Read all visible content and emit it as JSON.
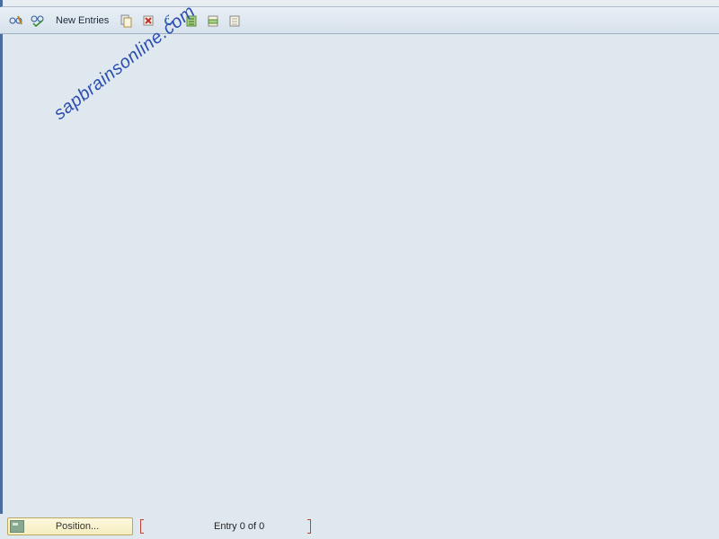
{
  "toolbar": {
    "display_details_tooltip": "Display/Change",
    "check_tooltip": "Check",
    "new_entries_label": "New Entries",
    "copy_tooltip": "Copy As",
    "delete_tooltip": "Delete",
    "undo_tooltip": "Undo",
    "select_all_tooltip": "Select All",
    "select_block_tooltip": "Select Block",
    "deselect_tooltip": "Deselect All"
  },
  "watermark": "sapbrainsonline.com",
  "footer": {
    "position_label": "Position...",
    "entry_status": "Entry 0 of 0"
  }
}
